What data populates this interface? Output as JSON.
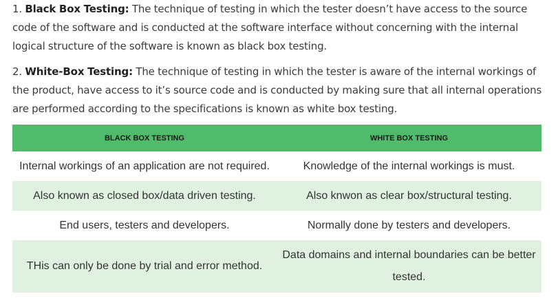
{
  "paragraphs": [
    {
      "number": "1.",
      "term": "Black Box Testing:",
      "text": "The technique of testing in which the tester doesn’t have access to the source code of the software and is conducted at the software interface without concerning with the internal logical structure of the software is known as black box testing."
    },
    {
      "number": "2.",
      "term": "White-Box Testing:",
      "text": "The technique of testing in which the tester is aware of the internal workings of the product, have access to it’s source code and is conducted by making sure that all internal operations are performed according to the specifications is known as white box testing."
    }
  ],
  "table": {
    "headers": [
      "BLACK BOX TESTING",
      "WHITE BOX TESTING"
    ],
    "rows": [
      [
        "Internal workings of an application are not required.",
        "Knowledge of the internal workings is must."
      ],
      [
        "Also known as closed box/data driven testing.",
        "Also knwon as clear box/structural testing."
      ],
      [
        "End users, testers and developers.",
        "Normally done by testers and developers."
      ],
      [
        "THis can only be done by trial and error method.",
        "Data domains and internal boundaries can be better tested."
      ]
    ]
  },
  "colors": {
    "header_bg": "#4fbb6b",
    "alt_row_bg": "#e0f1e2",
    "text": "#333333"
  }
}
